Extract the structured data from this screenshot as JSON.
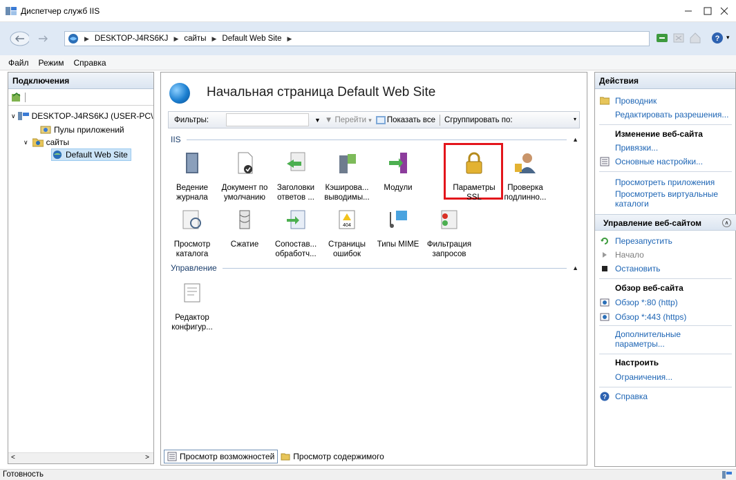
{
  "window": {
    "title": "Диспетчер служб IIS",
    "icon": "iis-manager-icon",
    "controls": [
      "minimize",
      "maximize",
      "close"
    ]
  },
  "address": {
    "breadcrumbs": [
      "DESKTOP-J4RS6KJ",
      "сайты",
      "Default Web Site"
    ],
    "toolbar_icons": [
      "connect-icon",
      "stop-icon",
      "home-icon",
      "help-icon"
    ]
  },
  "menu": [
    "Файл",
    "Режим",
    "Справка"
  ],
  "connections": {
    "header": "Подключения",
    "tree": [
      {
        "label": "DESKTOP-J4RS6KJ (USER-PC\\",
        "level": 0,
        "icon": "server-icon"
      },
      {
        "label": "Пулы приложений",
        "level": 1,
        "icon": "app-pools-icon"
      },
      {
        "label": "сайты",
        "level": 1,
        "icon": "sites-folder-icon"
      },
      {
        "label": "Default Web Site",
        "level": 2,
        "icon": "globe-icon",
        "selected": true
      }
    ]
  },
  "main": {
    "title": "Начальная страница Default Web Site",
    "filter": {
      "label": "Фильтры:",
      "value": "",
      "go": "Перейти",
      "show_all": "Показать все",
      "group_by": "Сгруппировать по:"
    },
    "groups": [
      {
        "name": "IIS",
        "features": [
          {
            "label": "Ведение журнала",
            "icon": "logging-icon"
          },
          {
            "label": "Документ по умолчанию",
            "icon": "default-document-icon"
          },
          {
            "label": "Заголовки ответов ...",
            "icon": "http-response-headers-icon"
          },
          {
            "label": "Кэширова... выводимы...",
            "icon": "output-caching-icon"
          },
          {
            "label": "Модули",
            "icon": "modules-icon"
          },
          {
            "label": "Параметры SSL",
            "icon": "ssl-lock-icon",
            "highlighted": true
          },
          {
            "label": "Проверка подлинно...",
            "icon": "authentication-icon"
          },
          {
            "label": "Просмотр каталога",
            "icon": "directory-browsing-icon"
          },
          {
            "label": "Сжатие",
            "icon": "compression-icon"
          },
          {
            "label": "Сопостав... обработч...",
            "icon": "handler-mappings-icon"
          },
          {
            "label": "Страницы ошибок",
            "icon": "error-pages-icon"
          },
          {
            "label": "Типы MIME",
            "icon": "mime-types-icon"
          },
          {
            "label": "Фильтрация запросов",
            "icon": "request-filtering-icon"
          }
        ]
      },
      {
        "name": "Управление",
        "features": [
          {
            "label": "Редактор конфигур...",
            "icon": "config-editor-icon"
          }
        ]
      }
    ],
    "view_tabs": [
      "Просмотр возможностей",
      "Просмотр содержимого"
    ]
  },
  "actions": {
    "header": "Действия",
    "explore": "Проводник",
    "edit_permissions": "Редактировать разрешения...",
    "edit_site_heading": "Изменение веб-сайта",
    "bindings": "Привязки...",
    "basic_settings": "Основные настройки...",
    "view_applications": "Просмотреть приложения",
    "view_virtual_dirs": "Просмотреть виртуальные каталоги",
    "manage_site_heading": "Управление веб-сайтом",
    "restart": "Перезапустить",
    "start": "Начало",
    "stop": "Остановить",
    "browse_heading": "Обзор веб-сайта",
    "browse_http": "Обзор *:80 (http)",
    "browse_https": "Обзор *:443 (https)",
    "advanced_settings": "Дополнительные параметры...",
    "configure_heading": "Настроить",
    "limits": "Ограничения...",
    "help": "Справка"
  },
  "status": {
    "text": "Готовность"
  },
  "colors": {
    "accent_link": "#1c64b4",
    "highlight_border": "#e3151b",
    "panel_header": "#dbe5f1",
    "address_bar": "#dfe9f5"
  }
}
